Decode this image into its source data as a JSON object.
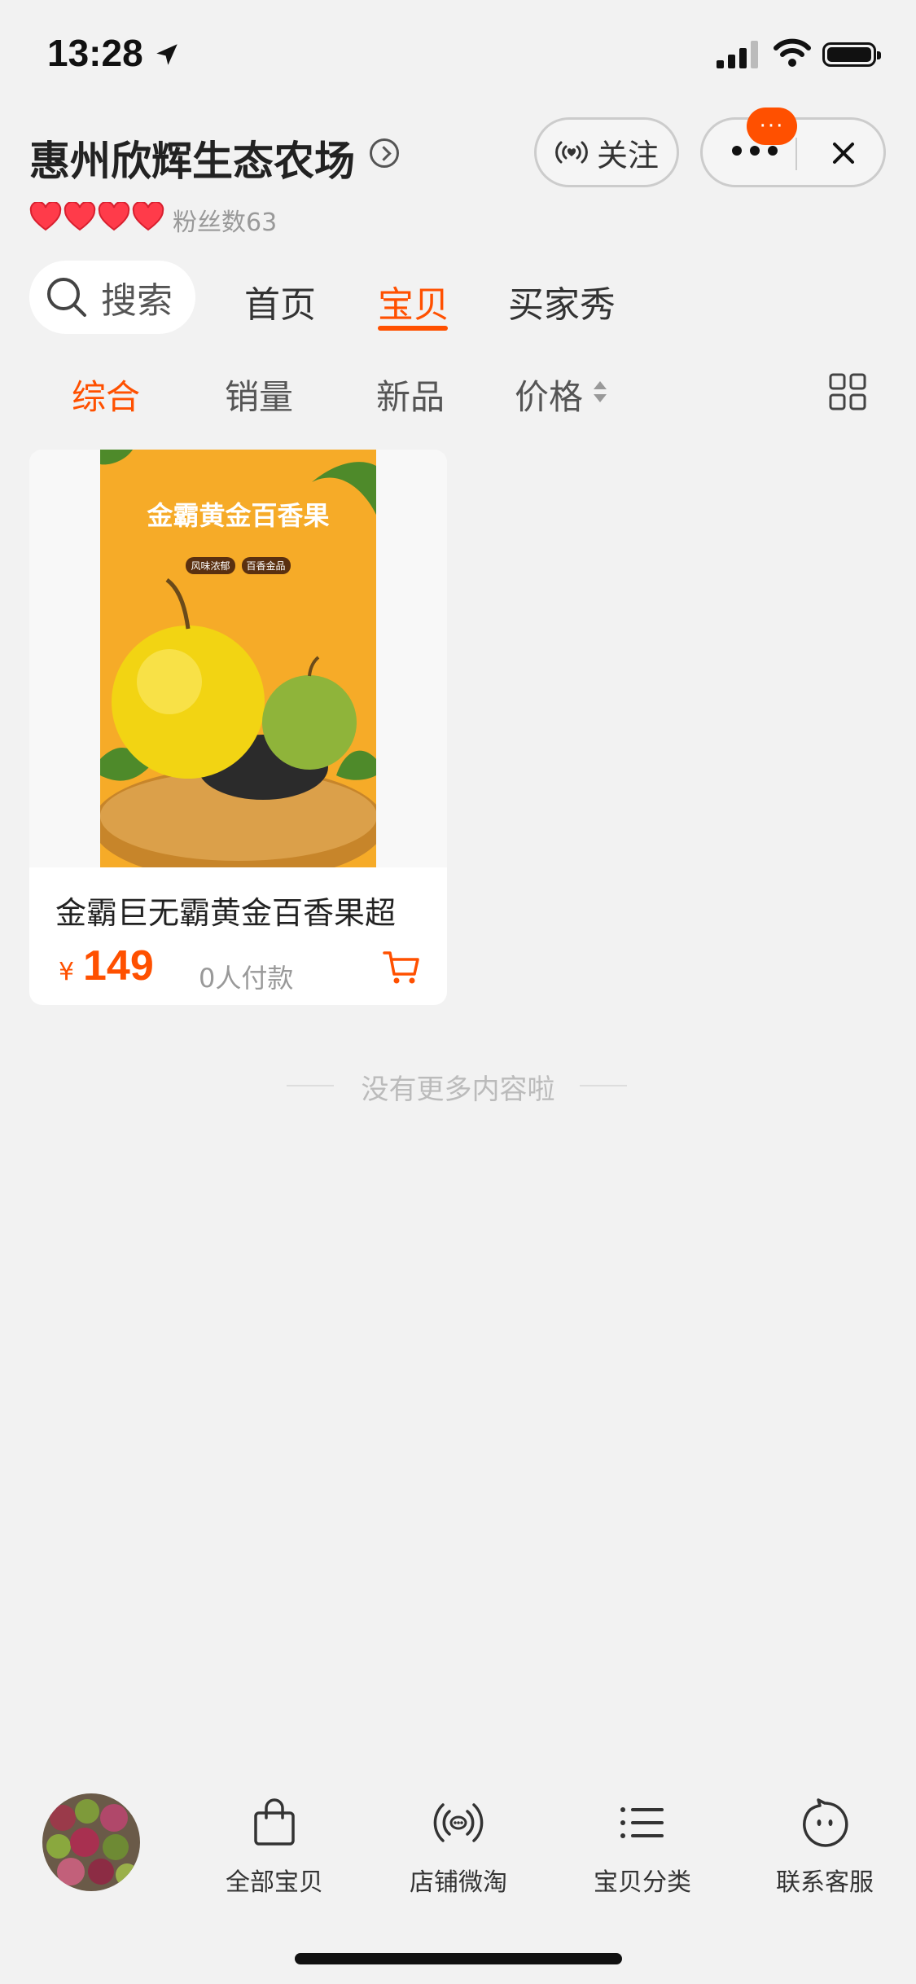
{
  "status_bar": {
    "time": "13:28"
  },
  "shop": {
    "name": "惠州欣辉生态农场",
    "fans_label": "粉丝数63",
    "follow_label": "关注",
    "notify_badge": "···"
  },
  "tabs": {
    "search_label": "搜索",
    "items": [
      "首页",
      "宝贝",
      "买家秀"
    ],
    "active": "宝贝"
  },
  "sort": {
    "items": [
      "综合",
      "销量",
      "新品",
      "价格"
    ],
    "active": "综合"
  },
  "product": {
    "title": "金霸巨无霸黄金百香果超",
    "currency": "¥",
    "price": "149",
    "paid_count": "0人付款",
    "poster_title": "金霸黄金百香果",
    "poster_tags": [
      "风味浓郁",
      "百香金品"
    ]
  },
  "list_end_text": "没有更多内容啦",
  "bottom_nav": {
    "items": [
      {
        "label": "全部宝贝",
        "icon": "shopping-bag-icon"
      },
      {
        "label": "店铺微淘",
        "icon": "broadcast-icon"
      },
      {
        "label": "宝贝分类",
        "icon": "list-icon"
      },
      {
        "label": "联系客服",
        "icon": "customer-service-icon"
      }
    ]
  },
  "colors": {
    "accent": "#ff5000",
    "background": "#f2f2f2"
  }
}
